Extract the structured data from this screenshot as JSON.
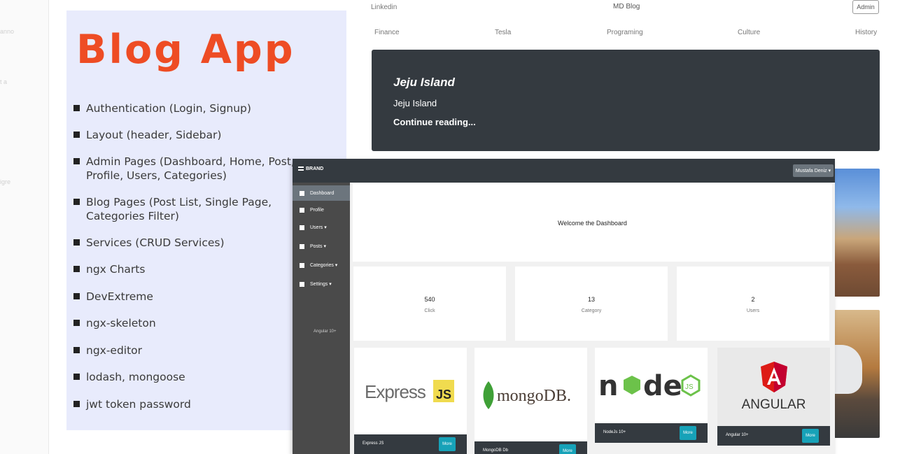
{
  "left_strip": [
    "anno",
    "t a",
    "igre"
  ],
  "feature_panel": {
    "title": "Blog App",
    "items": [
      "Authentication (Login, Signup)",
      "Layout (header, Sidebar)",
      "Admin Pages (Dashboard, Home, Post, Profile, Users, Categories)",
      "Blog Pages (Post List, Single Page, Categories Filter)",
      "Services (CRUD Services)",
      "ngx Charts",
      "DevExtreme",
      "ngx-skeleton",
      "ngx-editor",
      "lodash, mongoose",
      "jwt token password"
    ]
  },
  "blog": {
    "topbar_left": "Linkedin",
    "topbar_center": "MD Blog",
    "admin_button": "Admin",
    "nav": [
      "Finance",
      "Tesla",
      "Programing",
      "Culture",
      "History"
    ],
    "hero": {
      "title": "Jeju Island",
      "subtitle": "Jeju Island",
      "link": "Continue reading..."
    }
  },
  "dashboard": {
    "brand": "BRAND",
    "user_dropdown": "Mustafa Deniz ▾",
    "sidebar": [
      {
        "label": "Dashboard",
        "active": true
      },
      {
        "label": "Profile",
        "active": false
      },
      {
        "label": "Users ▾",
        "active": false
      },
      {
        "label": "Posts ▾",
        "active": false
      },
      {
        "label": "Categories ▾",
        "active": false
      },
      {
        "label": "Settings ▾",
        "active": false
      }
    ],
    "sidebar_footer": "Angular 10+",
    "welcome": "Welcome the Dashboard",
    "stats": [
      {
        "value": "540",
        "label": "Click"
      },
      {
        "value": "13",
        "label": "Category"
      },
      {
        "value": "2",
        "label": "Users"
      }
    ],
    "tech_cards": [
      {
        "logo": "Express JS",
        "caption": "Express JS",
        "more": "More"
      },
      {
        "logo": "mongoDB.",
        "caption": "MongoDB Db",
        "more": "More"
      },
      {
        "logo": "node js",
        "caption": "NodeJs 10+",
        "more": "More"
      },
      {
        "logo": "ANGULAR",
        "caption": "Angular 10+",
        "more": "More"
      }
    ]
  },
  "colors": {
    "title_orange": "#ee4c24",
    "panel_bg": "#e8ebfc",
    "dark": "#343a40",
    "sidebar": "#4a4a4a",
    "accent": "#17a2b8",
    "node_green": "#6cc24a",
    "mongo_green": "#3fa037",
    "angular_red": "#dd1b16",
    "express_yellow": "#f0db4f"
  }
}
